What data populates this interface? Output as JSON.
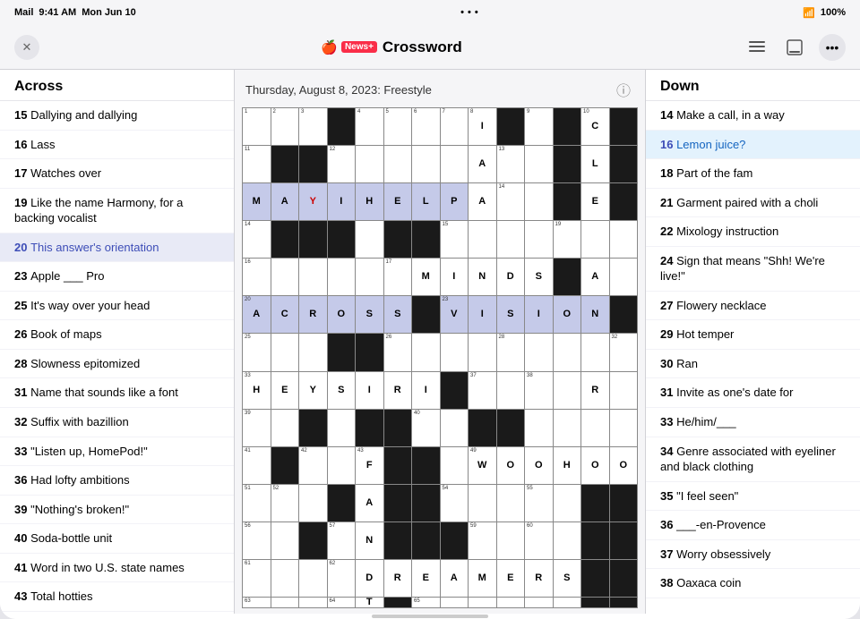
{
  "statusBar": {
    "carrier": "Mail",
    "time": "9:41 AM",
    "date": "Mon Jun 10",
    "wifi": "WiFi",
    "battery": "100%"
  },
  "topBar": {
    "closeLabel": "✕",
    "newsLogo": "",
    "plusBadge": "News+",
    "title": "Crossword",
    "listIcon": "≡",
    "screenIcon": "⊡",
    "moreIcon": "•••"
  },
  "gridHeader": {
    "title": "Thursday, August 8, 2023: Freestyle",
    "infoIcon": "ⓘ"
  },
  "acrossPanel": {
    "header": "Across",
    "clues": [
      {
        "number": "15",
        "text": "Dallying and dallying"
      },
      {
        "number": "16",
        "text": "Lass"
      },
      {
        "number": "17",
        "text": "Watches over"
      },
      {
        "number": "19",
        "text": "Like the name Harmony, for a backing vocalist"
      },
      {
        "number": "20",
        "text": "This answer's orientation",
        "active": true
      },
      {
        "number": "23",
        "text": "Apple ___ Pro"
      },
      {
        "number": "25",
        "text": "It's way over your head"
      },
      {
        "number": "26",
        "text": "Book of maps"
      },
      {
        "number": "28",
        "text": "Slowness epitomized"
      },
      {
        "number": "31",
        "text": "Name that sounds like a font"
      },
      {
        "number": "32",
        "text": "Suffix with bazillion"
      },
      {
        "number": "33",
        "text": "\"Listen up, HomePod!\""
      },
      {
        "number": "36",
        "text": "Had lofty ambitions"
      },
      {
        "number": "39",
        "text": "\"Nothing's broken!\""
      },
      {
        "number": "40",
        "text": "Soda-bottle unit"
      },
      {
        "number": "41",
        "text": "Word in two U.S. state names"
      },
      {
        "number": "43",
        "text": "Total hotties"
      }
    ]
  },
  "downPanel": {
    "header": "Down",
    "clues": [
      {
        "number": "14",
        "text": "Make a call, in a way"
      },
      {
        "number": "16",
        "text": "Lemon juice?",
        "active": true
      },
      {
        "number": "18",
        "text": "Part of the fam"
      },
      {
        "number": "21",
        "text": "Garment paired with a choli"
      },
      {
        "number": "22",
        "text": "Mixology instruction"
      },
      {
        "number": "24",
        "text": "Sign that means \"Shh! We're live!\""
      },
      {
        "number": "27",
        "text": "Flowery necklace"
      },
      {
        "number": "29",
        "text": "Hot temper"
      },
      {
        "number": "30",
        "text": "Ran"
      },
      {
        "number": "31",
        "text": "Invite as one's date for"
      },
      {
        "number": "33",
        "text": "He/him/___"
      },
      {
        "number": "34",
        "text": "Genre associated with eyeliner and black clothing"
      },
      {
        "number": "35",
        "text": "\"I feel seen\""
      },
      {
        "number": "36",
        "text": "___-en-Provence"
      },
      {
        "number": "37",
        "text": "Worry obsessively"
      },
      {
        "number": "38",
        "text": "Oaxaca coin"
      }
    ]
  },
  "grid": {
    "rows": 13,
    "cols": 14
  }
}
